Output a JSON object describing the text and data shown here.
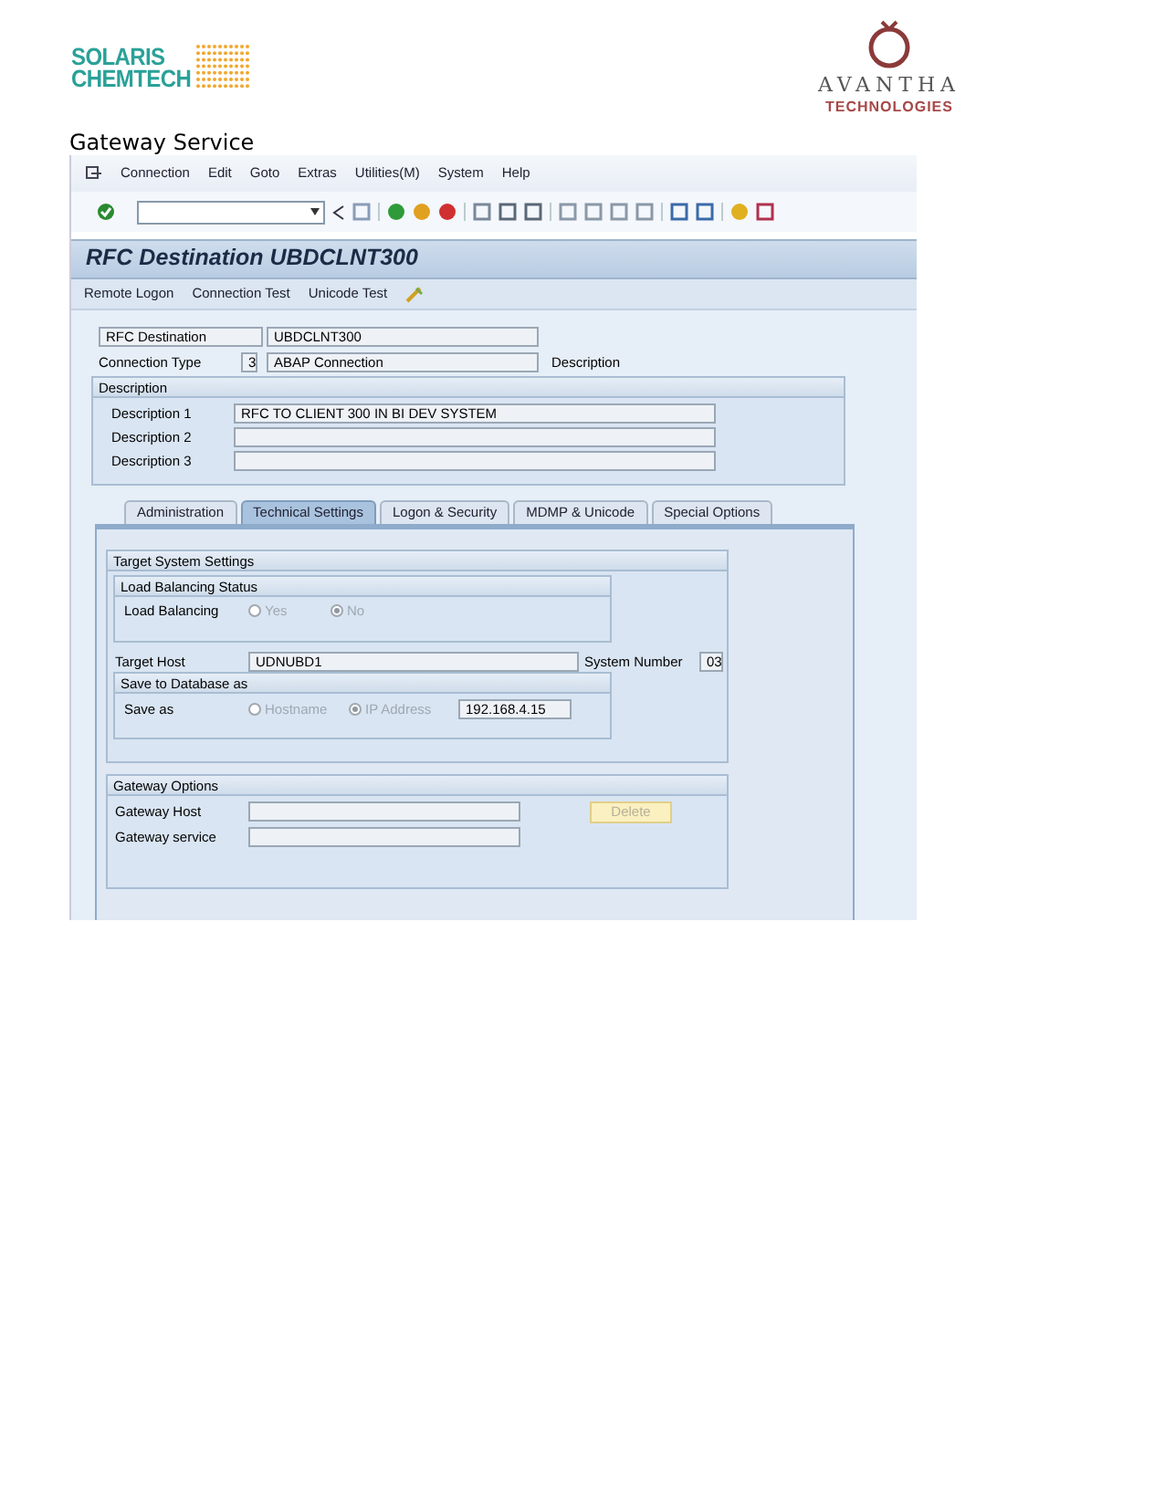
{
  "header": {
    "left_logo": [
      "SOLARIS",
      "CHEMTECH"
    ],
    "right_logo": {
      "name": "AVANTHA",
      "sub": "TECHNOLOGIES"
    }
  },
  "heading": "Gateway Service",
  "sap": {
    "menu": [
      "Connection",
      "Edit",
      "Goto",
      "Extras",
      "Utilities(M)",
      "System",
      "Help"
    ],
    "title": "RFC Destination UBDCLNT300",
    "app_toolbar": [
      "Remote Logon",
      "Connection Test",
      "Unicode Test"
    ],
    "rfc_destination": {
      "label": "RFC Destination",
      "value": "UBDCLNT300"
    },
    "connection_type": {
      "label": "Connection Type",
      "code": "3",
      "value": "ABAP Connection",
      "description": "Description"
    },
    "description_group": {
      "title": "Description",
      "rows": [
        {
          "label": "Description 1",
          "value": "RFC TO CLIENT 300 IN BI DEV SYSTEM"
        },
        {
          "label": "Description 2"
        },
        {
          "label": "Description 3"
        }
      ]
    },
    "tabs": [
      {
        "label": "Administration",
        "selected": false
      },
      {
        "label": "Technical Settings",
        "selected": true
      },
      {
        "label": "Logon & Security",
        "selected": false
      },
      {
        "label": "MDMP & Unicode",
        "selected": false
      },
      {
        "label": "Special Options",
        "selected": false
      }
    ],
    "target_system": {
      "title": "Target System Settings",
      "load_balancing": {
        "title": "Load Balancing Status",
        "label": "Load Balancing",
        "options": [
          {
            "label": "Yes",
            "selected": false
          },
          {
            "label": "No",
            "selected": true
          }
        ]
      },
      "target_host": {
        "label": "Target Host",
        "value": "UDNUBD1"
      },
      "system_number": {
        "label": "System Number",
        "value": "03"
      },
      "save_db": {
        "title": "Save to Database as",
        "label": "Save as",
        "options": [
          {
            "label": "Hostname",
            "selected": false
          },
          {
            "label": "IP Address",
            "selected": true
          }
        ],
        "value": "192.168.4.15"
      }
    },
    "gateway": {
      "title": "Gateway Options",
      "rows": [
        {
          "label": "Gateway Host"
        },
        {
          "label": "Gateway service"
        }
      ],
      "button": "Delete"
    }
  }
}
